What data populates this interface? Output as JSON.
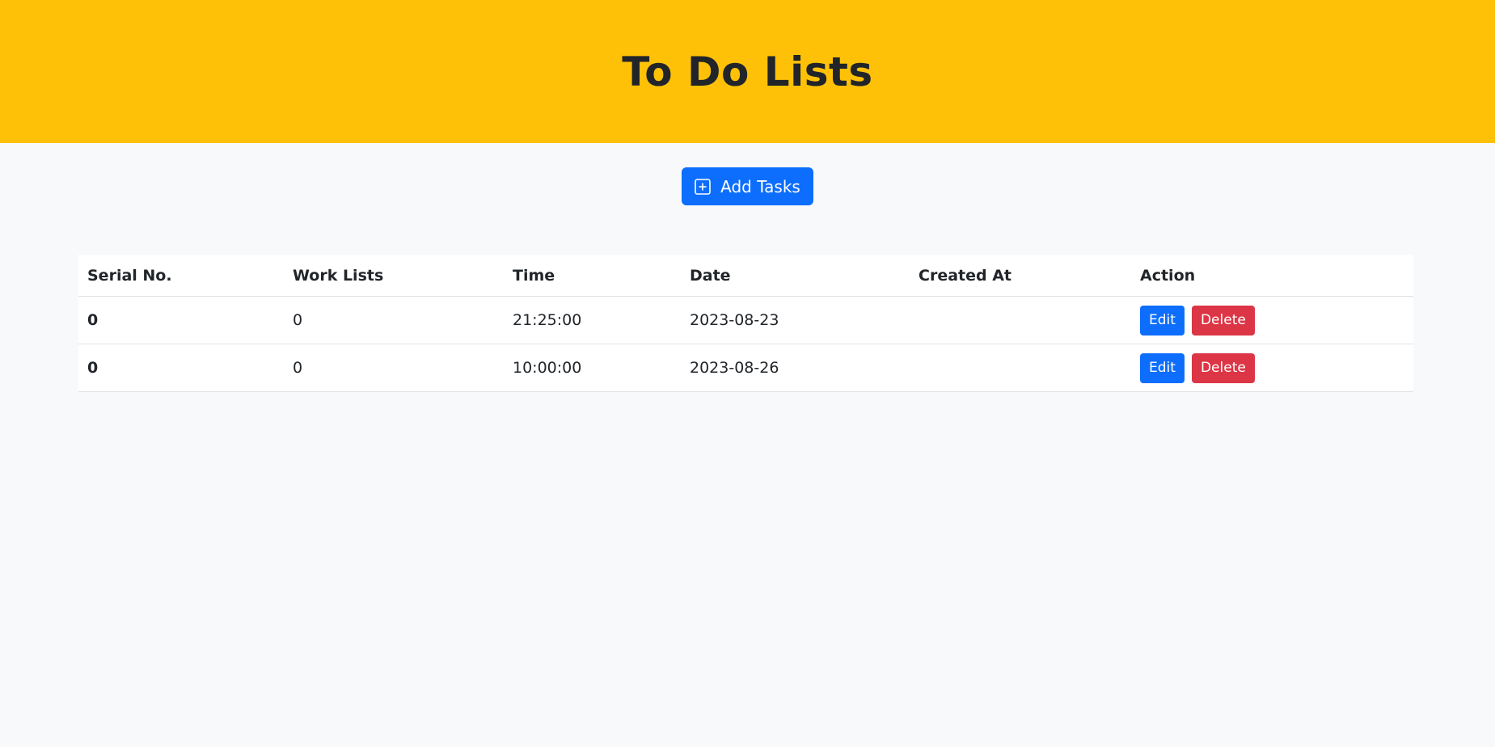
{
  "header": {
    "title": "To Do Lists"
  },
  "toolbar": {
    "add_label": "Add Tasks",
    "add_icon": "plus-square-icon"
  },
  "table": {
    "columns": [
      "Serial No.",
      "Work Lists",
      "Time",
      "Date",
      "Created At",
      "Action"
    ],
    "rows": [
      {
        "serial": "0",
        "work": "0",
        "time": "21:25:00",
        "date": "2023-08-23",
        "created_at": "",
        "edit_label": "Edit",
        "delete_label": "Delete"
      },
      {
        "serial": "0",
        "work": "0",
        "time": "10:00:00",
        "date": "2023-08-26",
        "created_at": "",
        "edit_label": "Edit",
        "delete_label": "Delete"
      }
    ]
  },
  "colors": {
    "header_bg": "#ffc107",
    "primary": "#0d6efd",
    "danger": "#dc3545",
    "page_bg": "#f8f9fa"
  }
}
